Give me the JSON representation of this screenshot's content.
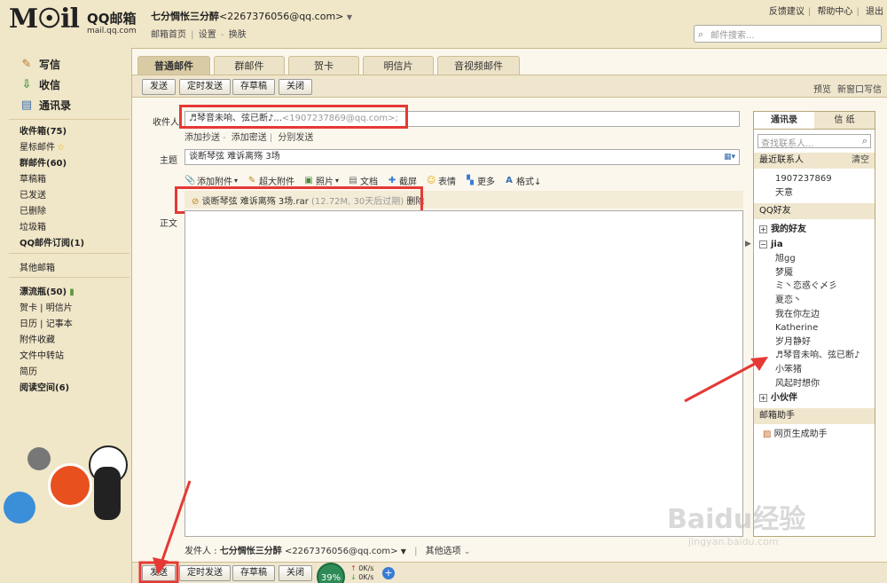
{
  "header": {
    "logo_text": "M☉il",
    "brand": "QQ邮箱",
    "domain": "mail.qq.com",
    "user_name": "七分惆怅三分醉",
    "user_email": "<2267376056@qq.com>",
    "links": [
      "邮箱首页",
      "设置",
      "换肤"
    ],
    "top_links": [
      "反馈建议",
      "帮助中心",
      "退出"
    ],
    "search_placeholder": "邮件搜索..."
  },
  "sidebar": {
    "actions": [
      "写信",
      "收信",
      "通讯录"
    ],
    "folders_a": [
      {
        "label": "收件箱(75)",
        "bold": true
      },
      {
        "label": "星标邮件",
        "star": true
      },
      {
        "label": "群邮件(60)",
        "bold": true
      },
      {
        "label": "草稿箱"
      },
      {
        "label": "已发送"
      },
      {
        "label": "已删除"
      },
      {
        "label": "垃圾箱"
      },
      {
        "label": "QQ邮件订阅(1)",
        "bold": true
      }
    ],
    "other_mailbox": "其他邮箱",
    "folders_b": [
      {
        "label": "漂流瓶(50)",
        "bold": true
      },
      {
        "label": "贺卡 | 明信片"
      },
      {
        "label": "日历 | 记事本"
      },
      {
        "label": "附件收藏"
      },
      {
        "label": "文件中转站"
      },
      {
        "label": "简历"
      },
      {
        "label": "阅读空间(6)",
        "bold": true
      }
    ]
  },
  "tabs": [
    "普通邮件",
    "群邮件",
    "贺卡",
    "明信片",
    "音视频邮件"
  ],
  "toolbar": {
    "send": "发送",
    "schedule": "定时发送",
    "draft": "存草稿",
    "close": "关闭",
    "preview": "预览",
    "new_window": "新窗口写信"
  },
  "compose": {
    "to_label": "收件人",
    "to_name": "♬琴音未响、弦已断♪...",
    "to_email": "<1907237869@qq.com>;",
    "cc_links": [
      "添加抄送",
      "添加密送",
      "分别发送"
    ],
    "subject_label": "主题",
    "subject_value": "谈断琴弦 难诉离殇 3场",
    "tools": [
      "添加附件",
      "超大附件",
      "照片",
      "文档",
      "截屏",
      "表情",
      "更多",
      "格式↓"
    ],
    "attachment_name": "谈断琴弦 难诉离殇 3场.rar",
    "attachment_meta": "(12.72M, 30天后过期)",
    "attachment_delete": "删除",
    "body_label": "正文",
    "sender_label": "发件人 :",
    "sender_name": "七分惆怅三分醉",
    "sender_email": "<2267376056@qq.com>",
    "other_options": "其他选项"
  },
  "bottom": {
    "progress": "39%",
    "speed_up": "0K/s",
    "speed_down": "0K/s"
  },
  "contacts_panel": {
    "tabs": [
      "通讯录",
      "信 纸"
    ],
    "search_placeholder": "查找联系人...",
    "recent_title": "最近联系人",
    "clear": "清空",
    "recent": [
      "1907237869",
      "天意"
    ],
    "qq_friends_title": "QQ好友",
    "groups": [
      {
        "name": "我的好友",
        "box": "+",
        "members": []
      },
      {
        "name": "jia",
        "box": "−",
        "members": [
          "旭gg",
          "梦魇",
          "ミ丶恋惑ぐ〆彡",
          "夏恋丶",
          "我在你左边",
          "Katherine",
          "岁月静好",
          "♬琴音未响、弦已断♪",
          "小笨猪",
          "风起时想你"
        ]
      },
      {
        "name": "小伙伴",
        "box": "+",
        "members": []
      }
    ],
    "assistant_title": "邮箱助手",
    "assistant_item": "网页生成助手"
  },
  "watermark": {
    "big": "Baidu经验",
    "small": "jingyan.baidu.com"
  },
  "colors": {
    "highlight": "#e53935",
    "background": "#f0e6c8",
    "panel": "#fbf7ec"
  }
}
